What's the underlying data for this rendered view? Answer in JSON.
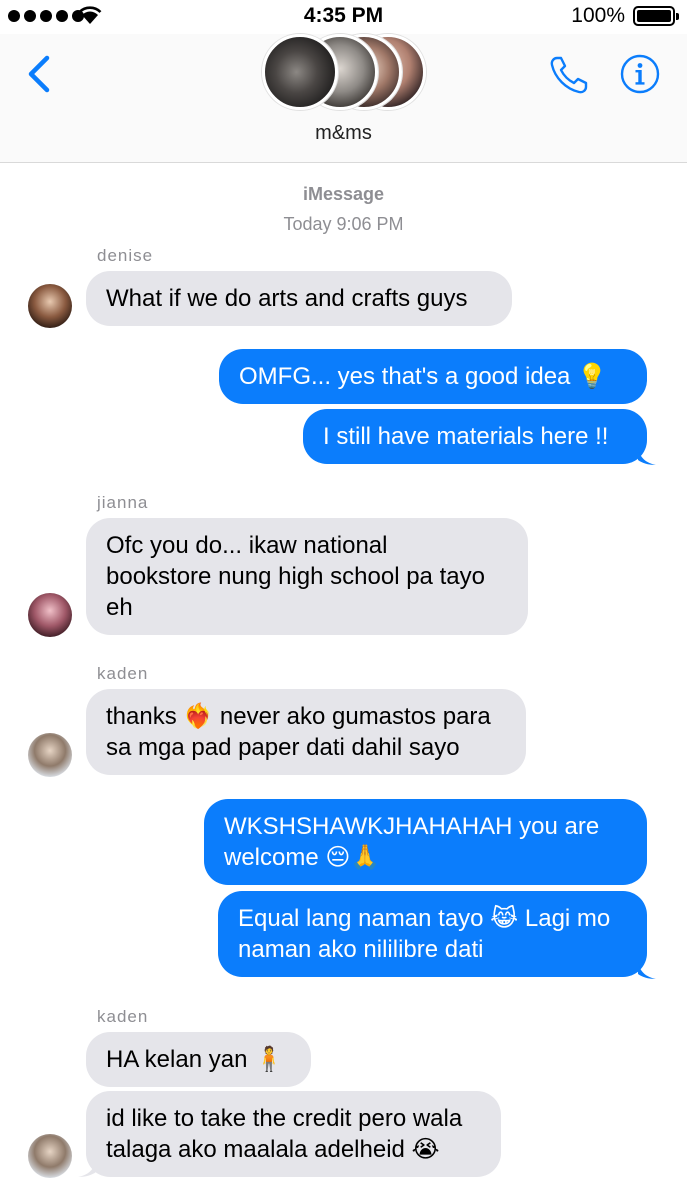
{
  "status_bar": {
    "time": "4:35 PM",
    "battery_percent": "100%",
    "battery_level": 1.0,
    "signal_dots": 5,
    "icons": [
      "signal-dots-icon",
      "wifi-icon",
      "battery-icon"
    ]
  },
  "header": {
    "group_name": "m&ms",
    "icons": [
      "back-chevron-icon",
      "phone-icon",
      "info-icon"
    ]
  },
  "conversation": {
    "service": "iMessage",
    "timestamp": "Today 9:06 PM",
    "messages": [
      {
        "sender": "denise",
        "direction": "incoming",
        "text": "What if we do arts and crafts guys"
      },
      {
        "direction": "outgoing",
        "text": "OMFG... yes that's a good idea 💡"
      },
      {
        "direction": "outgoing",
        "text": "I still have materials here !!"
      },
      {
        "sender": "jianna",
        "direction": "incoming",
        "lines": [
          "Ofc you do... ikaw national",
          "bookstore nung high school pa tayo",
          "eh"
        ]
      },
      {
        "sender": "kaden",
        "direction": "incoming",
        "lines": [
          "thanks ❤️‍🔥 never ako gumastos para",
          "sa mga pad paper dati dahil sayo"
        ]
      },
      {
        "direction": "outgoing",
        "lines": [
          "WKSHSHAWKJHAHAHAH you are",
          "welcome 😔🙏"
        ]
      },
      {
        "direction": "outgoing",
        "lines": [
          "Equal lang naman tayo 😹 Lagi mo",
          "naman ako nililibre dati"
        ]
      },
      {
        "sender": "kaden",
        "direction": "incoming",
        "text": "HA kelan yan 🧍"
      },
      {
        "direction": "incoming",
        "lines": [
          "id like to take the credit pero wala",
          "talaga ako maalala adelheid 😭"
        ]
      }
    ]
  },
  "colors": {
    "outgoing_bubble": "#0b7dfc",
    "incoming_bubble": "#e5e5ea",
    "accent": "#0b7dfc",
    "meta_text": "#8e8e93"
  }
}
